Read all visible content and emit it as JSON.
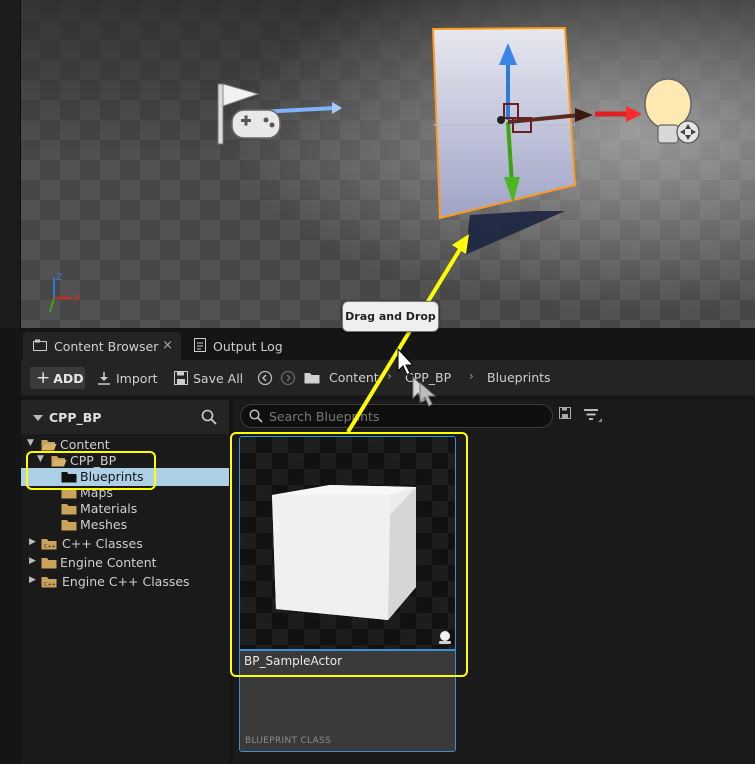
{
  "tooltip": "Drag and Drop",
  "tabs": [
    {
      "label": "Content Browser"
    },
    {
      "label": "Output Log"
    }
  ],
  "toolbar": {
    "add_label": "ADD",
    "import_label": "Import",
    "save_all_label": "Save All",
    "breadcrumb": [
      "Content",
      "CPP_BP",
      "Blueprints"
    ]
  },
  "tree": {
    "title": "CPP_BP",
    "items": [
      {
        "label": "Content",
        "expanded": true
      },
      {
        "label": "CPP_BP",
        "expanded": true
      },
      {
        "label": "Blueprints",
        "selected": true
      },
      {
        "label": "Maps"
      },
      {
        "label": "Materials"
      },
      {
        "label": "Meshes"
      },
      {
        "label": "C++ Classes"
      },
      {
        "label": "Engine Content"
      },
      {
        "label": "Engine C++ Classes"
      }
    ]
  },
  "search": {
    "placeholder": "Search Blueprints"
  },
  "asset": {
    "name": "BP_SampleActor",
    "type_label": "BLUEPRINT CLASS"
  },
  "colors": {
    "highlight": "#ffff00",
    "selection": "#aed0e6",
    "tile_border": "#3b8fd4",
    "folder": "#c9a25c",
    "gizmo_x": "#e02020",
    "gizmo_y": "#3ba314",
    "gizmo_z": "#2f7cd8"
  },
  "icons": [
    "flag-icon",
    "gamepad-icon",
    "light-bulb-icon",
    "folder-icon",
    "search-icon",
    "filter-icon",
    "save-icon",
    "output-log-icon",
    "content-browser-icon"
  ]
}
